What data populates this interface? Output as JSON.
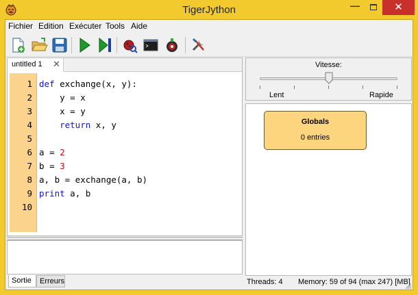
{
  "window": {
    "title": "TigerJython",
    "minimize_glyph": "—",
    "close_glyph": "✕"
  },
  "menu": [
    "Fichier",
    "Edition",
    "Exécuter",
    "Tools",
    "Aide"
  ],
  "toolbar": [
    {
      "icon": "new-file-icon"
    },
    {
      "icon": "open-folder-icon"
    },
    {
      "icon": "save-icon"
    },
    {
      "icon": "run-icon"
    },
    {
      "icon": "step-icon"
    },
    {
      "icon": "debug-bug-icon"
    },
    {
      "icon": "console-icon"
    },
    {
      "icon": "robot-icon"
    },
    {
      "icon": "tools-icon"
    }
  ],
  "editor": {
    "tab_label": "untitled 1",
    "tab_close": "✕",
    "line_numbers": [
      "1",
      "2",
      "3",
      "4",
      "5",
      "6",
      "7",
      "8",
      "9",
      "10"
    ],
    "code": [
      "def exchange(x, y):",
      "    y = x",
      "    x = y",
      "    return x, y",
      "",
      "a = 2",
      "b = 3",
      "a, b = exchange(a, b)",
      "print a, b",
      ""
    ]
  },
  "output_tabs": [
    "Sortie",
    "Erreurs"
  ],
  "speed": {
    "label": "Vitesse:",
    "min_label": "Lent",
    "max_label": "Rapide",
    "value_fraction": 0.5
  },
  "debugger": {
    "globals_title": "Globals",
    "globals_count": "0 entries"
  },
  "status": {
    "threads": "Threads: 4",
    "memory": "Memory: 59 of 94 (max 247) [MB]"
  },
  "colors": {
    "window_frame": "#f2ca2e",
    "gutter": "#fbd38c",
    "globals_box": "#fed57f",
    "keyword": "#1414c8",
    "number": "#c01010",
    "close_button": "#c7302b"
  }
}
